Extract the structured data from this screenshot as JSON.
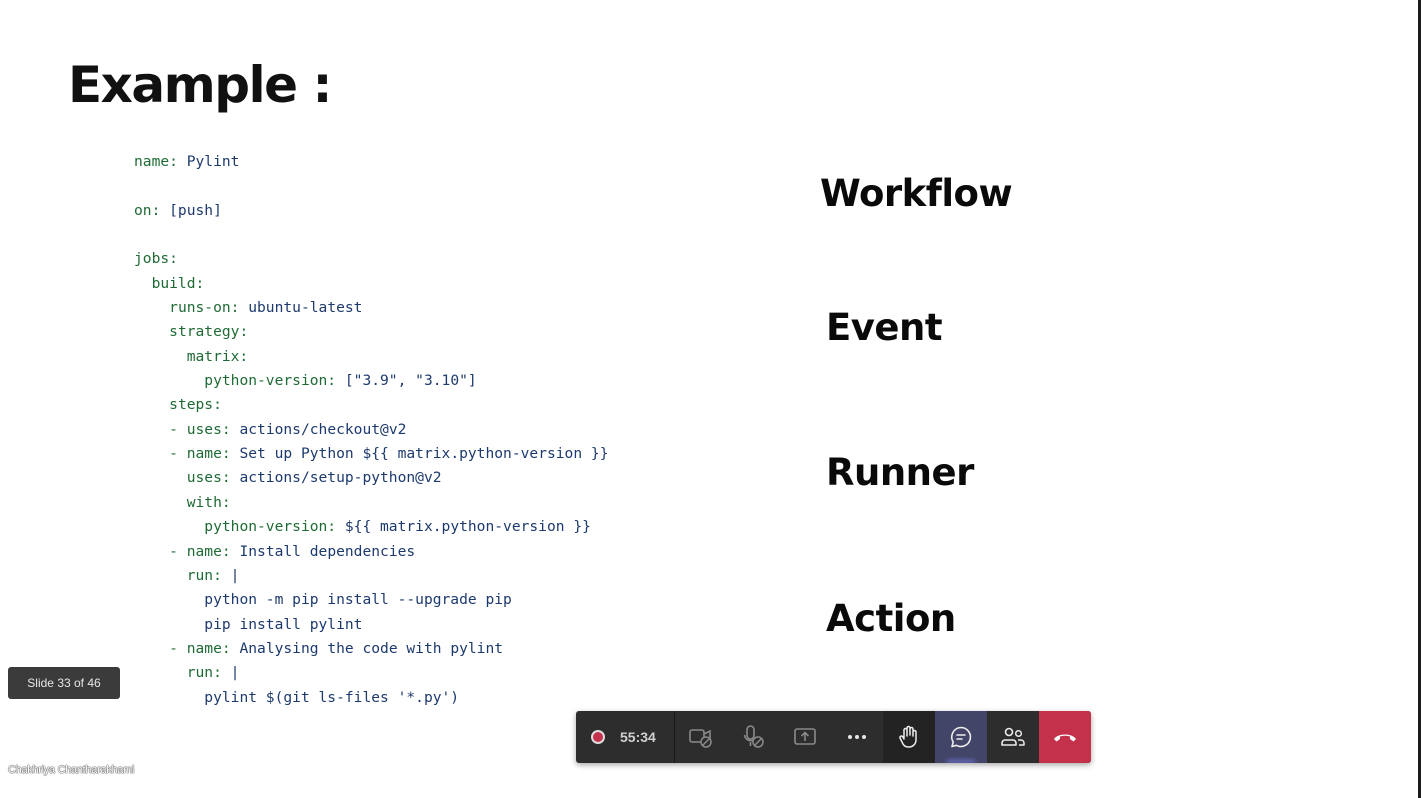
{
  "slide": {
    "title": "Example :",
    "code_lines": [
      {
        "indent": "",
        "key": "name:",
        "value": " Pylint"
      },
      {
        "indent": "",
        "key": "",
        "value": ""
      },
      {
        "indent": "",
        "key": "on:",
        "value": " [push]"
      },
      {
        "indent": "",
        "key": "",
        "value": ""
      },
      {
        "indent": "",
        "key": "jobs:",
        "value": ""
      },
      {
        "indent": "  ",
        "key": "build:",
        "value": ""
      },
      {
        "indent": "    ",
        "key": "runs-on:",
        "value": " ubuntu-latest"
      },
      {
        "indent": "    ",
        "key": "strategy:",
        "value": ""
      },
      {
        "indent": "      ",
        "key": "matrix:",
        "value": ""
      },
      {
        "indent": "        ",
        "key": "python-version:",
        "value": " [\"3.9\", \"3.10\"]"
      },
      {
        "indent": "    ",
        "key": "steps:",
        "value": ""
      },
      {
        "indent": "    ",
        "key": "- uses:",
        "value": " actions/checkout@v2"
      },
      {
        "indent": "    ",
        "key": "- name:",
        "value": " Set up Python ${{ matrix.python-version }}"
      },
      {
        "indent": "      ",
        "key": "uses:",
        "value": " actions/setup-python@v2"
      },
      {
        "indent": "      ",
        "key": "with:",
        "value": ""
      },
      {
        "indent": "        ",
        "key": "python-version:",
        "value": " ${{ matrix.python-version }}"
      },
      {
        "indent": "    ",
        "key": "- name:",
        "value": " Install dependencies"
      },
      {
        "indent": "      ",
        "key": "run:",
        "value": " |"
      },
      {
        "indent": "        ",
        "key": "",
        "value": "python -m pip install --upgrade pip"
      },
      {
        "indent": "        ",
        "key": "",
        "value": "pip install pylint"
      },
      {
        "indent": "    ",
        "key": "- name:",
        "value": " Analysing the code with pylint"
      },
      {
        "indent": "      ",
        "key": "run:",
        "value": " |"
      },
      {
        "indent": "        ",
        "key": "",
        "value": "pylint $(git ls-files '*.py')"
      }
    ],
    "labels": {
      "workflow": "Workflow",
      "event": "Event",
      "runner": "Runner",
      "action": "Action"
    }
  },
  "slide_counter": "Slide 33 of 46",
  "presenter_name": "Chakhriya Chantharakhami",
  "meeting_bar": {
    "recording_time": "55:34",
    "icons": {
      "camera": "camera-off-icon",
      "mic": "mic-off-icon",
      "share": "share-screen-icon",
      "more": "more-options-icon",
      "hand": "raise-hand-icon",
      "chat": "chat-icon",
      "people": "participants-icon",
      "leave": "hang-up-icon"
    },
    "colors": {
      "record": "#c4314b",
      "leave": "#c4314b",
      "chat_active": "#434568"
    }
  }
}
